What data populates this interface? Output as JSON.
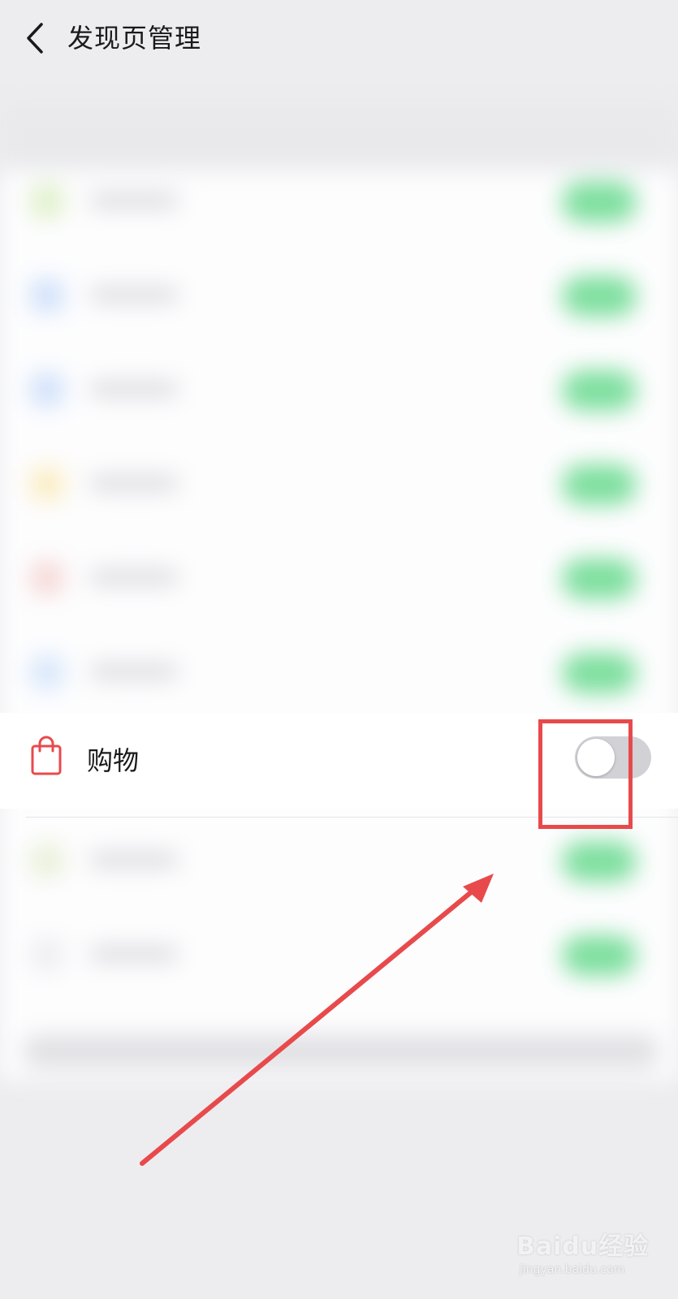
{
  "header": {
    "title": "发现页管理",
    "back_icon": "chevron-left-icon"
  },
  "shopping_row": {
    "label": "购物",
    "icon": "shopping-bag-icon",
    "icon_color": "#e84a4c",
    "toggle_on": false,
    "toggle_off_color": "#d2d1d6"
  },
  "blurred_rows": {
    "toggle_color": "#7ddf9e"
  },
  "annotation": {
    "color": "#e84a4c"
  },
  "watermark": {
    "brand": "Baidu经验",
    "url": "jingyan.baidu.com"
  }
}
